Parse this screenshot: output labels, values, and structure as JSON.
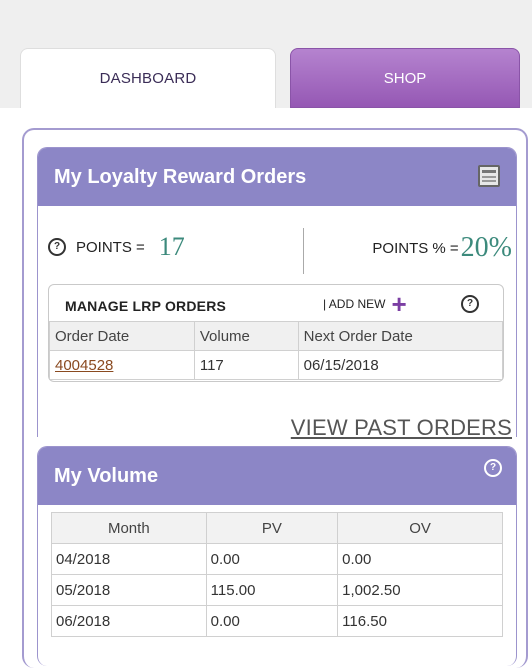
{
  "tabs": {
    "dashboard": "DASHBOARD",
    "shop": "SHOP"
  },
  "lrp_panel": {
    "title": "My Loyalty Reward Orders",
    "points_label": "POINTS =",
    "points_value": "17",
    "points_pct_label": "POINTS % =",
    "points_pct_value": "20%",
    "manage_title": "MANAGE LRP ORDERS",
    "add_new": "| ADD NEW",
    "columns": [
      "Order Date",
      "Volume",
      "Next Order Date"
    ],
    "rows": [
      {
        "order": "4004528",
        "volume": "117",
        "next_date": "06/15/2018"
      }
    ],
    "view_past_orders": "VIEW PAST ORDERS"
  },
  "volume_panel": {
    "title": "My Volume",
    "columns": [
      "Month",
      "PV",
      "OV"
    ],
    "rows": [
      {
        "month": "04/2018",
        "pv": "0.00",
        "ov": "0.00"
      },
      {
        "month": "05/2018",
        "pv": "115.00",
        "ov": "1,002.50"
      },
      {
        "month": "06/2018",
        "pv": "0.00",
        "ov": "116.50"
      }
    ]
  },
  "icons": [
    "help-icon",
    "calculator-icon",
    "plus-icon"
  ],
  "colors": {
    "panel_header": "#8c86c6",
    "shop_tab": "#9b5cb8",
    "points_value": "#3c8a7c",
    "order_link": "#8a4a20"
  }
}
